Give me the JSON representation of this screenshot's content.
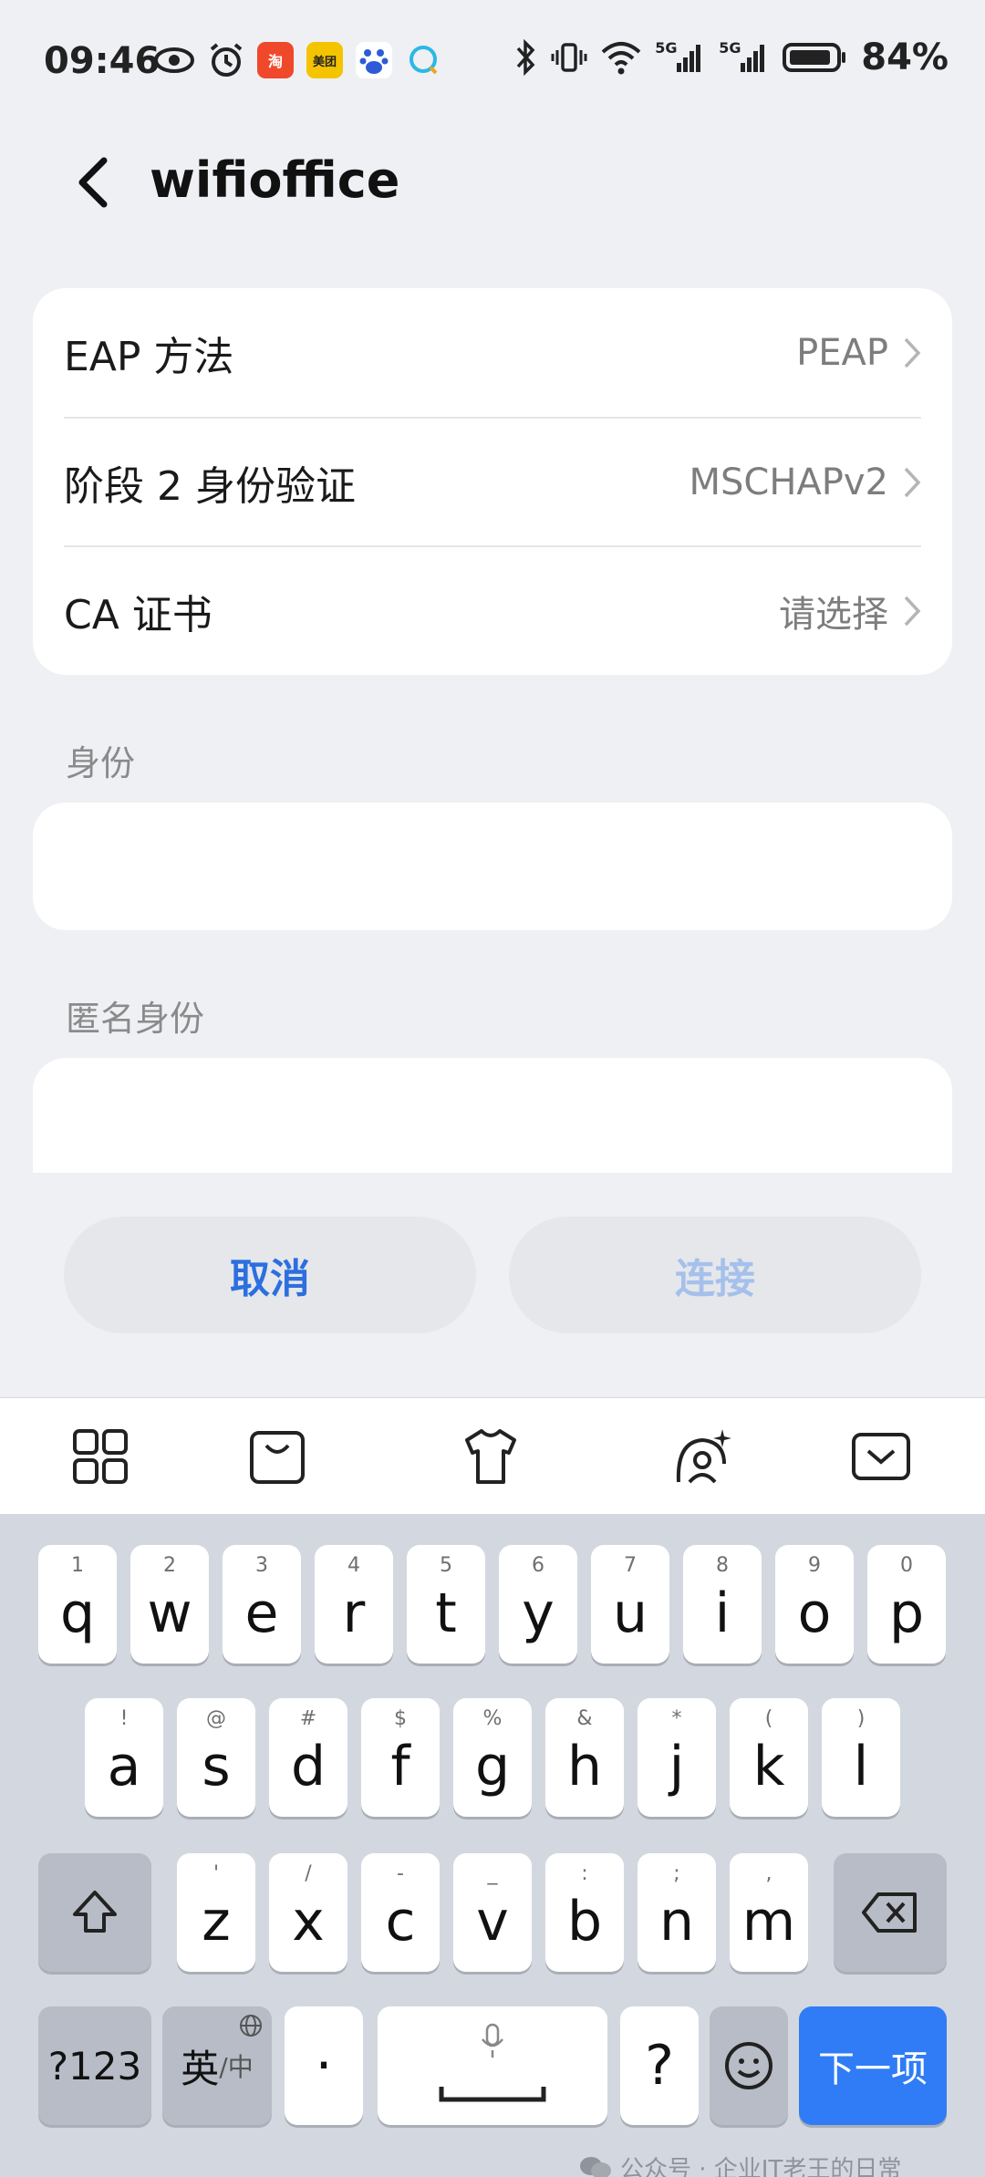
{
  "status": {
    "time": "09:46",
    "battery": "84%",
    "signal_label_1": "5G",
    "signal_label_2": "5G",
    "app_tao": "淘",
    "app_meituan": "美团"
  },
  "header": {
    "title": "wifioffice"
  },
  "settings": [
    {
      "label": "EAP 方法",
      "value": "PEAP"
    },
    {
      "label": "阶段 2 身份验证",
      "value": "MSCHAPv2"
    },
    {
      "label": "CA 证书",
      "value": "请选择"
    }
  ],
  "fields": {
    "identity_label": "身份",
    "anonymous_label": "匿名身份"
  },
  "buttons": {
    "cancel": "取消",
    "connect": "连接"
  },
  "keyboard": {
    "row1": [
      {
        "k": "q",
        "h": "1"
      },
      {
        "k": "w",
        "h": "2"
      },
      {
        "k": "e",
        "h": "3"
      },
      {
        "k": "r",
        "h": "4"
      },
      {
        "k": "t",
        "h": "5"
      },
      {
        "k": "y",
        "h": "6"
      },
      {
        "k": "u",
        "h": "7"
      },
      {
        "k": "i",
        "h": "8"
      },
      {
        "k": "o",
        "h": "9"
      },
      {
        "k": "p",
        "h": "0"
      }
    ],
    "row2": [
      {
        "k": "a",
        "h": "!"
      },
      {
        "k": "s",
        "h": "@"
      },
      {
        "k": "d",
        "h": "#"
      },
      {
        "k": "f",
        "h": "$"
      },
      {
        "k": "g",
        "h": "%"
      },
      {
        "k": "h",
        "h": "&"
      },
      {
        "k": "j",
        "h": "*"
      },
      {
        "k": "k",
        "h": "("
      },
      {
        "k": "l",
        "h": ")"
      }
    ],
    "row3": [
      {
        "k": "z",
        "h": "'"
      },
      {
        "k": "x",
        "h": "/"
      },
      {
        "k": "c",
        "h": "-"
      },
      {
        "k": "v",
        "h": "_"
      },
      {
        "k": "b",
        "h": ":"
      },
      {
        "k": "n",
        "h": ";"
      },
      {
        "k": "m",
        "h": ","
      }
    ],
    "num_key": "?123",
    "lang_key": "英",
    "lang_sub": "/中",
    "dot_key": "·",
    "question_key": "?",
    "next_key": "下一项"
  },
  "watermark": "公众号 · 企业IT老王的日常"
}
